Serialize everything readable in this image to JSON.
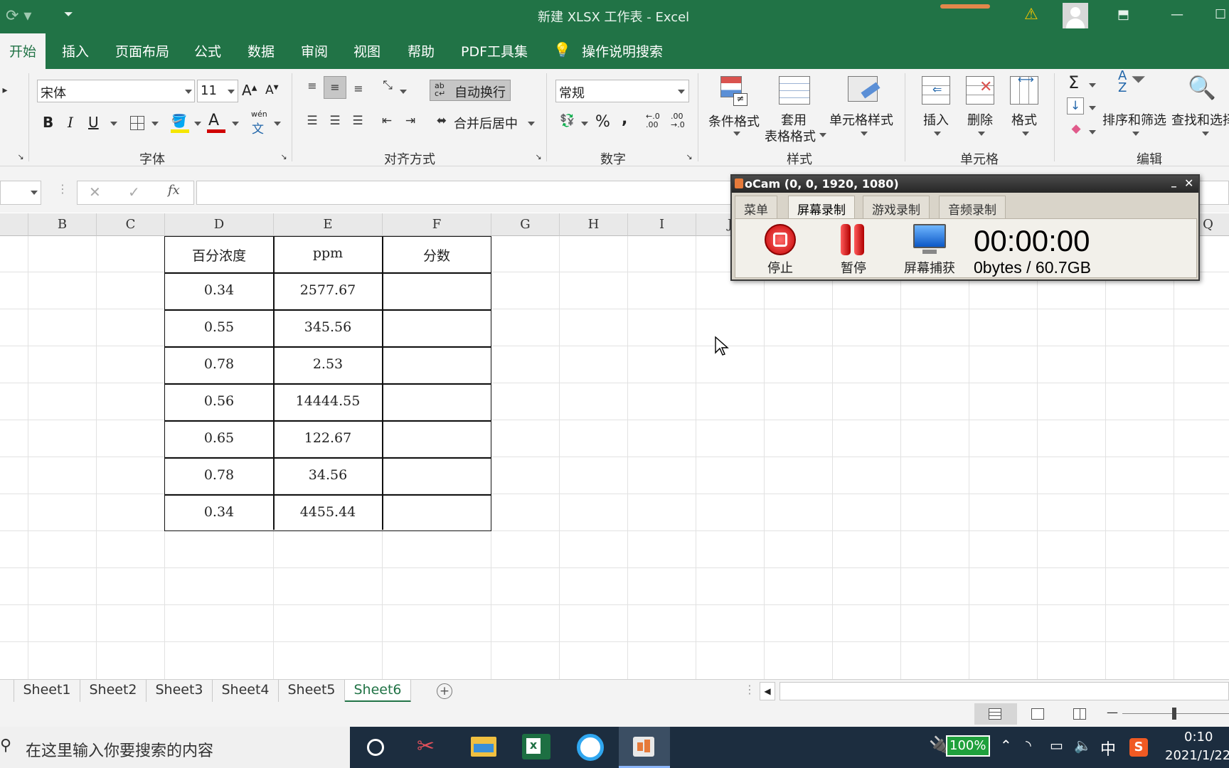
{
  "title_bar": {
    "title": "新建 XLSX 工作表  -  Excel",
    "warning_icon": "warning-icon"
  },
  "tabs": [
    "开始",
    "插入",
    "页面布局",
    "公式",
    "数据",
    "审阅",
    "视图",
    "帮助",
    "PDF工具集"
  ],
  "tell_me": "操作说明搜索",
  "ribbon": {
    "font_name": "宋体",
    "font_size": "11",
    "bold": "B",
    "italic": "I",
    "underline": "U",
    "wen": "wén",
    "wrap_text": "自动换行",
    "merge_center": "合并后居中",
    "number_format": "常规",
    "percent": "%",
    "comma": ",",
    "inc_decimal": ".0\n.00",
    "cond_format": "条件格式",
    "table_format_1": "套用",
    "table_format_2": "表格格式",
    "cell_styles": "单元格样式",
    "insert": "插入",
    "delete": "删除",
    "format": "格式",
    "sort_filter": "排序和筛选",
    "find_select": "查找和选择",
    "sigma": "Σ",
    "groups": {
      "font": "字体",
      "alignment": "对齐方式",
      "number": "数字",
      "styles": "样式",
      "cells": "单元格",
      "editing": "编辑"
    }
  },
  "formula_bar": {
    "fx": "fx",
    "cancel": "✕",
    "enter": "✓"
  },
  "columns": [
    "B",
    "C",
    "D",
    "E",
    "F",
    "G",
    "H",
    "I",
    "J",
    "Q"
  ],
  "table": {
    "headers": [
      "百分浓度",
      "ppm",
      "分数"
    ],
    "rows": [
      [
        "0.34",
        "2577.67",
        ""
      ],
      [
        "0.55",
        "345.56",
        ""
      ],
      [
        "0.78",
        "2.53",
        ""
      ],
      [
        "0.56",
        "14444.55",
        ""
      ],
      [
        "0.65",
        "122.67",
        ""
      ],
      [
        "0.78",
        "34.56",
        ""
      ],
      [
        "0.34",
        "4455.44",
        ""
      ]
    ]
  },
  "sheets": [
    "Sheet1",
    "Sheet2",
    "Sheet3",
    "Sheet4",
    "Sheet5",
    "Sheet6"
  ],
  "active_sheet": "Sheet6",
  "ocam": {
    "title": "oCam (0, 0, 1920, 1080)",
    "tabs": [
      "菜单",
      "屏幕录制",
      "游戏录制",
      "音频录制"
    ],
    "active_tab": "屏幕录制",
    "buttons": [
      "停止",
      "暂停",
      "屏幕捕获"
    ],
    "timer": "00:00:00",
    "size": "0bytes / 60.7GB"
  },
  "taskbar": {
    "search_placeholder": "在这里输入你要搜索的内容",
    "battery": "100%",
    "ime": "中",
    "time": "0:10",
    "date": "2021/1/22"
  },
  "colors": {
    "excel_green": "#217346",
    "ribbon_bg": "#f3f3f3",
    "taskbar": "#1c2d3f"
  }
}
